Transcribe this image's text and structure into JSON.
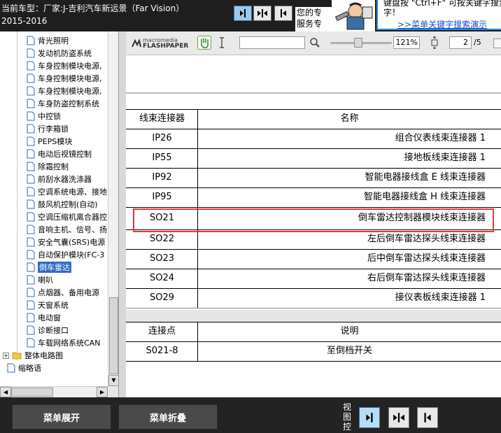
{
  "header": {
    "car_model": "当前车型：厂家:J-吉利汽车新远景（Far Vision）",
    "car_years": "2015-2016",
    "assist_line1": "您的专",
    "assist_line2": "服务专",
    "tip_line1": "键盘按 \"Ctrl+F\" 可按关键字搜索进行快速",
    "tip_line2": "字！",
    "tip_link": ">>菜单关键字搜索演示"
  },
  "sidebar": {
    "items": [
      {
        "label": "背光照明",
        "icon": "document-icon"
      },
      {
        "label": "发动机防盗系统",
        "icon": "document-icon"
      },
      {
        "label": "车身控制模块电源,",
        "icon": "document-icon"
      },
      {
        "label": "车身控制模块电源,",
        "icon": "document-icon"
      },
      {
        "label": "车身控制模块电源,",
        "icon": "document-icon"
      },
      {
        "label": "车身防盗控制系统",
        "icon": "document-icon"
      },
      {
        "label": "中控锁",
        "icon": "document-icon"
      },
      {
        "label": "行李箱锁",
        "icon": "document-icon"
      },
      {
        "label": "PEPS模块",
        "icon": "document-icon"
      },
      {
        "label": "电动后视镜控制",
        "icon": "document-icon"
      },
      {
        "label": "除霜控制",
        "icon": "document-icon"
      },
      {
        "label": "前刮水器洗涤器",
        "icon": "document-icon"
      },
      {
        "label": "空调系统电源、接地",
        "icon": "document-icon"
      },
      {
        "label": "鼓风机控制(自动)",
        "icon": "document-icon"
      },
      {
        "label": "空调压缩机离合器控",
        "icon": "document-icon"
      },
      {
        "label": "音响主机、信号、扬",
        "icon": "document-icon"
      },
      {
        "label": "安全气囊(SRS)电源",
        "icon": "document-icon"
      },
      {
        "label": "自动保护模块(FC-3",
        "icon": "document-icon"
      },
      {
        "label": "倒车雷达",
        "icon": "document-icon",
        "selected": true
      },
      {
        "label": "喇叭",
        "icon": "document-icon"
      },
      {
        "label": "点烟器、备用电源",
        "icon": "document-icon"
      },
      {
        "label": "天窗系统",
        "icon": "document-icon"
      },
      {
        "label": "电动窗",
        "icon": "document-icon"
      },
      {
        "label": "诊断接口",
        "icon": "document-icon"
      },
      {
        "label": "车载网络系统CAN",
        "icon": "document-icon"
      }
    ],
    "folder": {
      "label": "整体电路图",
      "expander": "+"
    },
    "abbrev": {
      "label": "缩略语"
    }
  },
  "flashpaper": {
    "brand_top": "macromedia",
    "brand_bottom": "FLASHPAPER",
    "zoom": "121%",
    "zoom_level": 0.45,
    "page": "2",
    "page_total": "/5"
  },
  "document": {
    "connector_table": {
      "headers": [
        "线束连接器",
        "名称"
      ],
      "rows": [
        [
          "IP26",
          "组合仪表线束连接器 1"
        ],
        [
          "IP55",
          "接地板线束连接器 1"
        ],
        [
          "IP92",
          "智能电器接线盒 E 线束连接器"
        ],
        [
          "IP95",
          "智能电器接线盒 H 线束连接器"
        ],
        [
          "SO21",
          "倒车雷达控制器模块线束连接器"
        ],
        [
          "SO22",
          "左后倒车雷达探头线束连接器"
        ],
        [
          "SO23",
          "后中倒车雷达探头线束连接器"
        ],
        [
          "SO24",
          "右后倒车雷达探头线束连接器"
        ],
        [
          "SO29",
          "接仪表板线束连接器 1"
        ]
      ]
    },
    "point_table": {
      "headers": [
        "连接点",
        "说明"
      ],
      "rows": [
        [
          "S021-8",
          "至倒档开关"
        ]
      ]
    }
  },
  "bottom": {
    "expand_label": "菜单展开",
    "collapse_label": "菜单折叠",
    "view_control_label": "视图控"
  },
  "colors": {
    "highlight_border": "#e03b3b",
    "selection": "#316ac5",
    "tip_border": "#2b8ad8"
  }
}
